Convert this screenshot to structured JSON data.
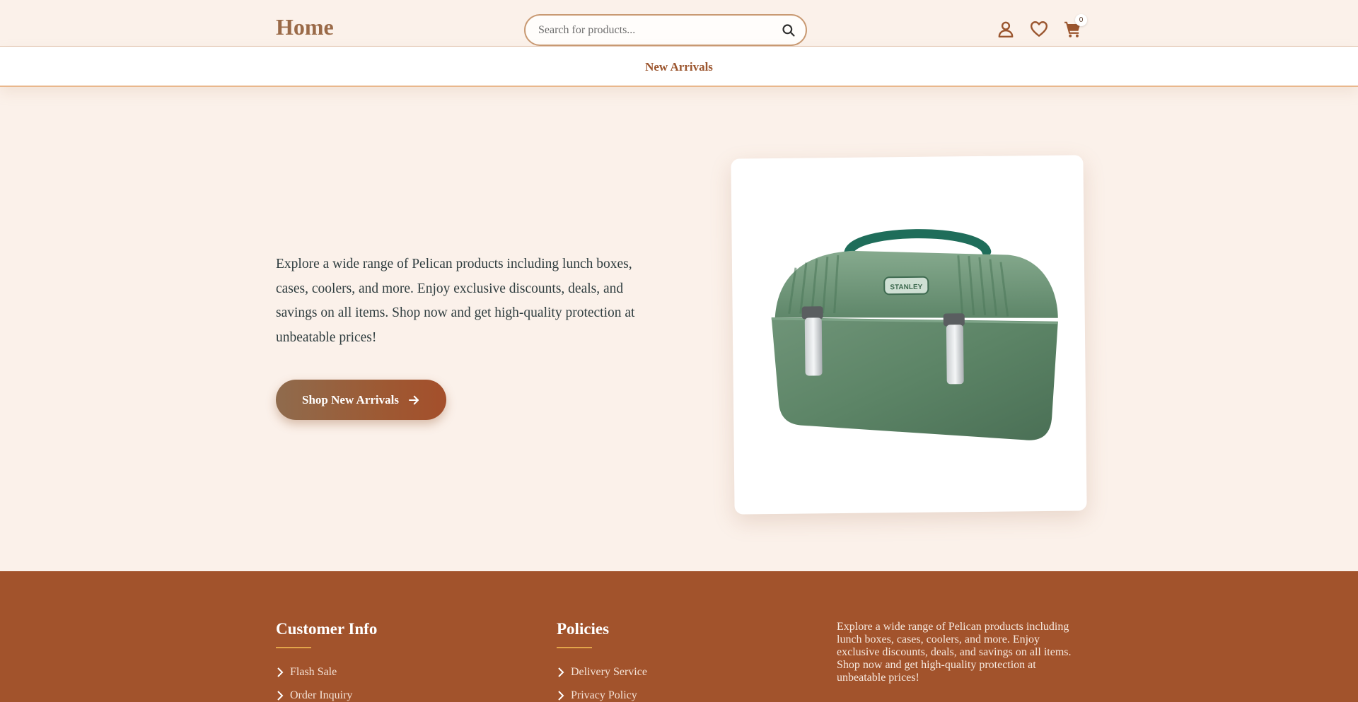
{
  "header": {
    "logo": "Home",
    "search_placeholder": "Search for products...",
    "icons": [
      "user-icon",
      "heart-icon",
      "cart-icon",
      "search-icon"
    ],
    "cart_count": "0"
  },
  "nav": {
    "links": [
      "New Arrivals"
    ]
  },
  "hero": {
    "description": "Explore a wide range of Pelican products including lunch boxes, cases, coolers, and more. Enjoy exclusive discounts, deals, and savings on all items. Shop now and get high-quality protection at unbeatable prices!",
    "cta_label": "Shop New Arrivals",
    "product_image": "green-stanley-lunch-box"
  },
  "footer": {
    "customer_info": {
      "title": "Customer Info",
      "links": [
        "Flash Sale",
        "Order Inquiry"
      ]
    },
    "policies": {
      "title": "Policies",
      "links": [
        "Delivery Service",
        "Privacy Policy"
      ]
    },
    "about": "Explore a wide range of Pelican products including lunch boxes, cases, coolers, and more. Enjoy exclusive discounts, deals, and savings on all items. Shop now and get high-quality protection at unbeatable prices!"
  },
  "colors": {
    "page_background": "#fbf1ea",
    "brand_brown": "#9b552e",
    "footer_background": "#a2532c",
    "accent_rule": "#e3a54a"
  }
}
